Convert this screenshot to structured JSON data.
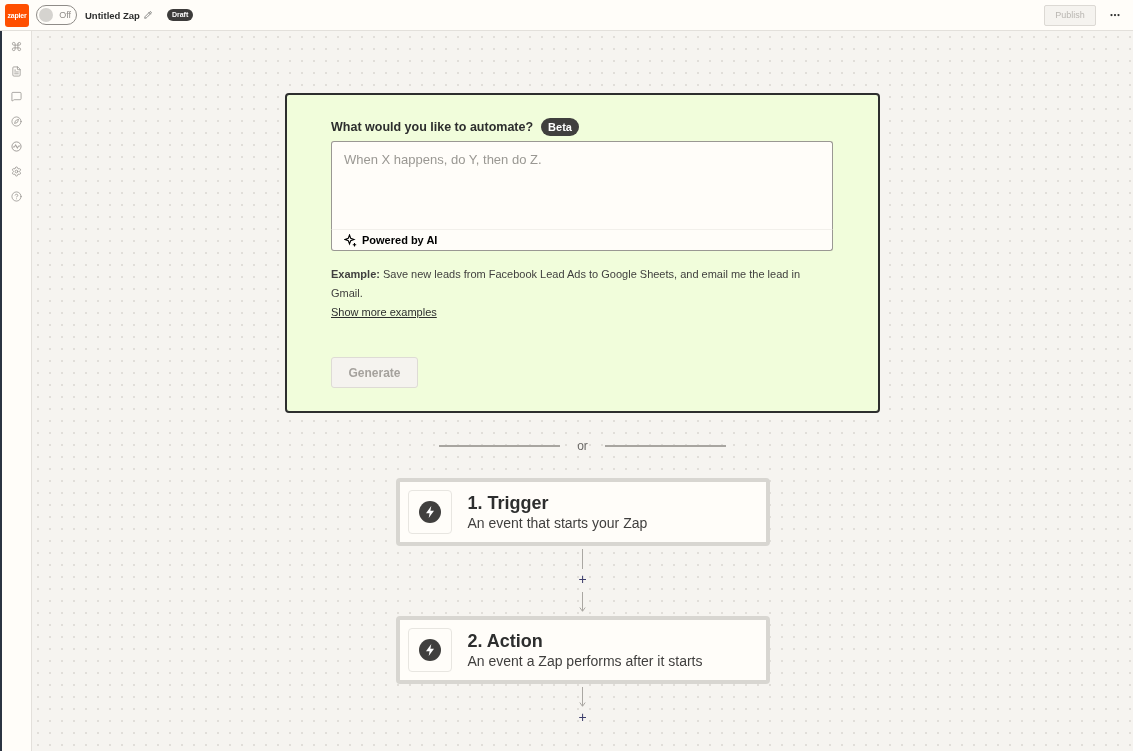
{
  "top_bar": {
    "logo": "zapier",
    "toggle": {
      "label": "Off",
      "on": false
    },
    "title": "Untitled Zap",
    "status_badge": "Draft",
    "publish_button": {
      "label": "Publish",
      "disabled": true
    }
  },
  "ai_builder": {
    "label": "What would you like to automate?",
    "badge": "Beta",
    "prompt": {
      "placeholder": "When X happens, do Y, then do Z."
    },
    "footer": "Powered by AI",
    "example": "**Example:** Save new leads from Facebook Lead Ads to Google Sheets, and email me the lead in Gmail.",
    "link": "Show more examples",
    "generate_button": {
      "label": "Generate",
      "disabled": true
    }
  },
  "divider": "or",
  "steps": [
    {
      "title": "1. Trigger",
      "subtitle": "An event that starts your Zap",
      "add_button": "+"
    },
    {
      "title": "2. Action",
      "subtitle": "An event a Zap performs after it starts",
      "add_button": "+"
    }
  ]
}
